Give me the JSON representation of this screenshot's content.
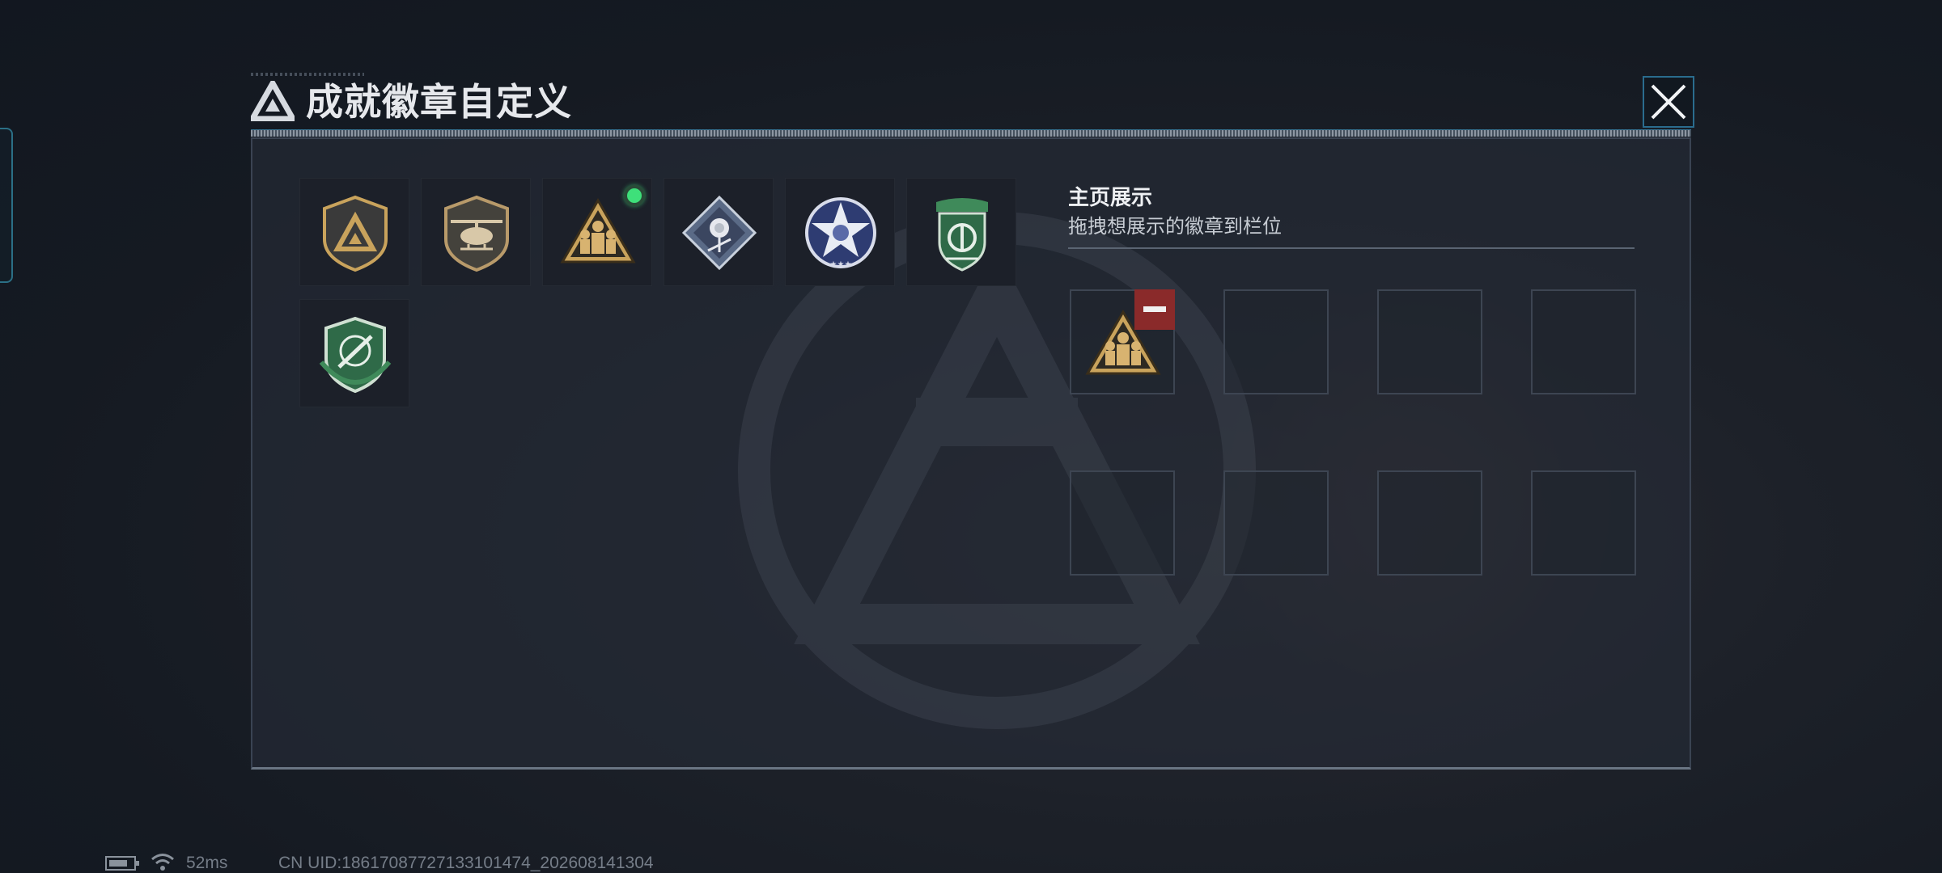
{
  "window": {
    "title": "成就徽章自定义",
    "title_icon": "triangle-logo-icon",
    "close_icon": "close-icon"
  },
  "badges": [
    {
      "name": "triangle-shield-badge",
      "selected": false
    },
    {
      "name": "helicopter-badge",
      "selected": false
    },
    {
      "name": "soldiers-triangle-badge",
      "selected": true
    },
    {
      "name": "diamond-rose-badge",
      "selected": false
    },
    {
      "name": "star-eagle-badge",
      "selected": false
    },
    {
      "name": "green-shield-badge",
      "selected": false
    },
    {
      "name": "green-rocket-badge",
      "selected": false
    }
  ],
  "showcase": {
    "title": "主页展示",
    "subtitle": "拖拽想展示的徽章到栏位",
    "slots": [
      {
        "badge": "soldiers-triangle-badge",
        "removable": true
      },
      {
        "badge": null
      },
      {
        "badge": null
      },
      {
        "badge": null
      },
      {
        "badge": null
      },
      {
        "badge": null
      },
      {
        "badge": null
      },
      {
        "badge": null
      }
    ]
  },
  "footer": {
    "ping": "52ms",
    "uid": "CN UID:18617087727133101474_202608141304"
  },
  "colors": {
    "selected_dot": "#3ee07a",
    "remove_button": "#8a2a2a",
    "gold": "#c9a35c",
    "green_badge": "#2f6a48"
  }
}
